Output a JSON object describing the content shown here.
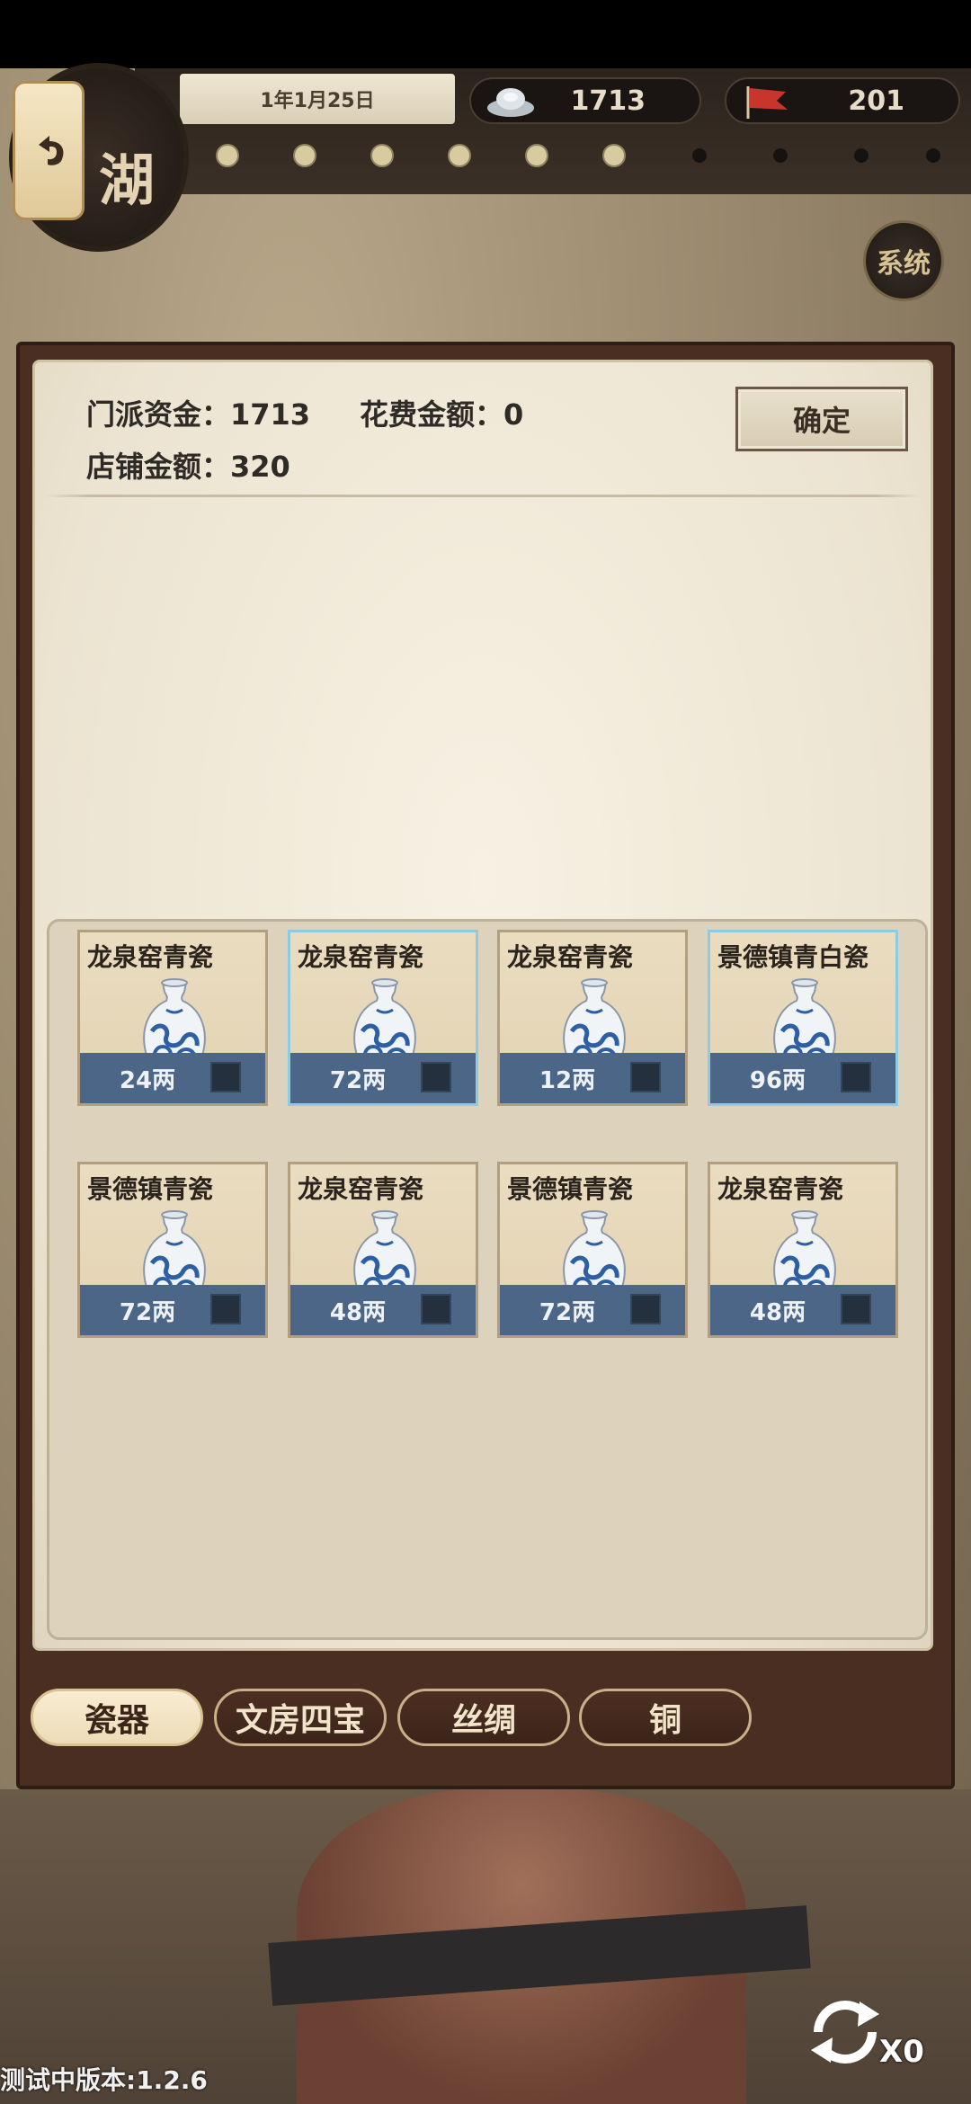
{
  "header": {
    "date": "1年1月25日",
    "silver": "1713",
    "flags": "201",
    "logo_char": "湖",
    "system_label": "系统"
  },
  "shop": {
    "sect_funds": "门派资金：1713",
    "spent": "花费金额：0",
    "shop_funds": "店铺金额：320",
    "confirm_label": "确定"
  },
  "items": [
    {
      "name": "龙泉窑青瓷",
      "price": "24两",
      "selected": false
    },
    {
      "name": "龙泉窑青瓷",
      "price": "72两",
      "selected": true
    },
    {
      "name": "龙泉窑青瓷",
      "price": "12两",
      "selected": false
    },
    {
      "name": "景德镇青白瓷",
      "price": "96两",
      "selected": true
    },
    {
      "name": "景德镇青瓷",
      "price": "72两",
      "selected": false
    },
    {
      "name": "龙泉窑青瓷",
      "price": "48两",
      "selected": false
    },
    {
      "name": "景德镇青瓷",
      "price": "72两",
      "selected": false
    },
    {
      "name": "龙泉窑青瓷",
      "price": "48两",
      "selected": false
    }
  ],
  "tabs": [
    {
      "label": "瓷器",
      "active": true
    },
    {
      "label": "文房四宝",
      "active": false
    },
    {
      "label": "丝绸",
      "active": false
    },
    {
      "label": "铜",
      "active": false
    }
  ],
  "footer": {
    "version": "测试中版本:1.2.6",
    "refresh_count": "X0"
  },
  "colors": {
    "card_footer": "#4b6686",
    "paper": "#f3eddf",
    "frame": "#4a2e22"
  }
}
